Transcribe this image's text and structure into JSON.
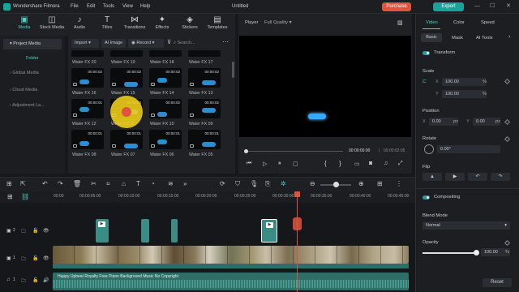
{
  "app": {
    "name": "Wondershare Filmora",
    "project": "Untitled"
  },
  "menu": [
    "File",
    "Edit",
    "Tools",
    "View",
    "Help"
  ],
  "titlebar": {
    "purchase": "Purchase",
    "export": "Export"
  },
  "media_tabs": [
    {
      "label": "Media",
      "icon": "media-icon"
    },
    {
      "label": "Stock Media",
      "icon": "stock-media-icon"
    },
    {
      "label": "Audio",
      "icon": "audio-icon"
    },
    {
      "label": "Titles",
      "icon": "titles-icon"
    },
    {
      "label": "Transitions",
      "icon": "transitions-icon"
    },
    {
      "label": "Effects",
      "icon": "effects-icon"
    },
    {
      "label": "Stickers",
      "icon": "stickers-icon"
    },
    {
      "label": "Templates",
      "icon": "templates-icon"
    }
  ],
  "sidebar": {
    "project_media": "Project Media",
    "folder": "Folder",
    "items": [
      "Global Media",
      "Cloud Media",
      "Adjustment La..."
    ]
  },
  "media_toolbar": {
    "import": "Import",
    "ai_image": "AI Image",
    "record": "Record",
    "search_placeholder": "Search..."
  },
  "tiles": [
    {
      "label": "Water FX 20"
    },
    {
      "label": "Water FX 19"
    },
    {
      "label": "Water FX 18"
    },
    {
      "label": "Water FX 17"
    },
    {
      "label": "Water FX 16",
      "time": "00:00:02"
    },
    {
      "label": "Water FX 15",
      "time": "00:00:02"
    },
    {
      "label": "Water FX 14",
      "time": "00:00:02"
    },
    {
      "label": "Water FX 13",
      "time": "00:00:02"
    },
    {
      "label": "Water FX 12",
      "time": "00:00:01"
    },
    {
      "label": "Water FX 11",
      "time": "00:00:03"
    },
    {
      "label": "Water FX 10",
      "time": "00:00:02"
    },
    {
      "label": "Water FX 09",
      "time": "00:00:02"
    },
    {
      "label": "Water FX 08",
      "time": "00:00:01"
    },
    {
      "label": "Water FX 07",
      "time": "00:00:01"
    },
    {
      "label": "Water FX 06",
      "time": "00:00:01"
    },
    {
      "label": "Water FX 05",
      "time": "00:00:01"
    }
  ],
  "player": {
    "label": "Player",
    "quality": "Full Quality",
    "current_time": "00:00:00:00",
    "total_time": "00:00:02:05"
  },
  "right_panel": {
    "tabs": [
      "Video",
      "Color",
      "Speed"
    ],
    "subtabs": [
      "Basic",
      "Mask",
      "AI Tools"
    ],
    "transform": "Transform",
    "scale": "Scale",
    "scale_x": "100.00",
    "scale_y": "100.00",
    "percent": "%",
    "position": "Position",
    "pos_x": "0.00",
    "pos_y": "0.00",
    "px": "px",
    "rotate": "Rotate",
    "rotate_value": "0.00°",
    "flip": "Flip",
    "compositing": "Compositing",
    "blend_mode": "Blend Mode",
    "blend_value": "Normal",
    "opacity": "Opacity",
    "opacity_value": "100.00",
    "opacity_level": 1.0,
    "reset": "Reset",
    "x": "X",
    "y": "Y"
  },
  "ruler": [
    "00:00",
    "00:00:05:00",
    "00:00:10:00",
    "00:00:15:00",
    "00:00:20:00",
    "00:00:25:00",
    "00:00:30:00",
    "00:00:35:00",
    "00:00:40:00",
    "00:00:45:00"
  ],
  "tracks": {
    "video2": "2",
    "video1": "1",
    "audio1": "1",
    "audio_clip": "Happy Upbeat Royalty Free Piano Background Music No Copyright"
  },
  "colors": {
    "accent": "#4fd1c5",
    "export": "#1aa39a",
    "purchase": "#e0533f",
    "playhead": "#e0533f",
    "clip": "#3a8c84",
    "highlight": "#f2d21b"
  }
}
